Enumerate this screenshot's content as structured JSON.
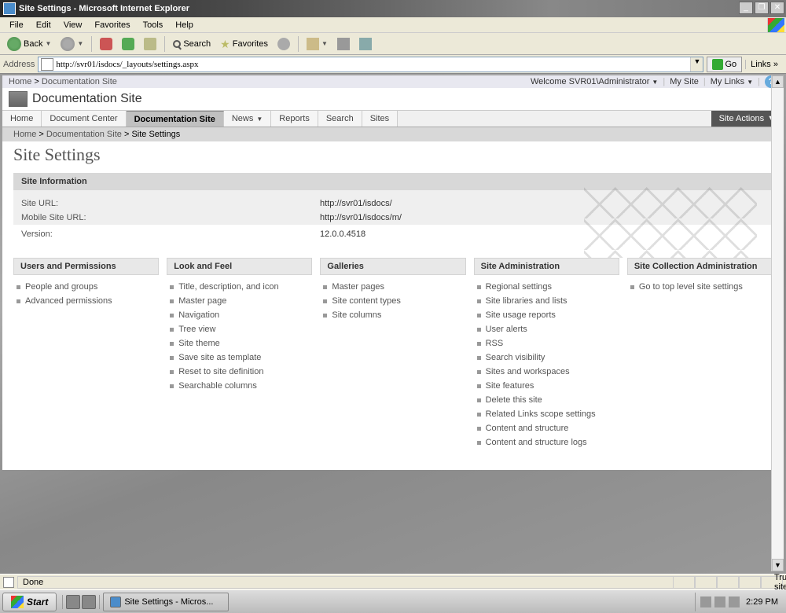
{
  "window": {
    "title": "Site Settings - Microsoft Internet Explorer",
    "controls": {
      "min": "_",
      "max": "❐",
      "close": "✕"
    }
  },
  "menubar": {
    "file": "File",
    "edit": "Edit",
    "view": "View",
    "favorites": "Favorites",
    "tools": "Tools",
    "help": "Help"
  },
  "toolbar": {
    "back": "Back",
    "search": "Search",
    "favorites": "Favorites"
  },
  "address": {
    "label": "Address",
    "url": "http://svr01/isdocs/_layouts/settings.aspx",
    "go": "Go",
    "links": "Links"
  },
  "sp": {
    "topcrumb_home": "Home",
    "topcrumb_site": "Documentation Site",
    "welcome": "Welcome SVR01\\Administrator",
    "mysite": "My Site",
    "mylinks": "My Links",
    "site_title": "Documentation Site",
    "tabs": {
      "home": "Home",
      "doccenter": "Document Center",
      "docsite": "Documentation Site",
      "news": "News",
      "reports": "Reports",
      "search": "Search",
      "sites": "Sites"
    },
    "site_actions": "Site Actions",
    "bc": {
      "home": "Home",
      "docsite": "Documentation Site",
      "settings": "Site Settings"
    },
    "h1": "Site Settings",
    "info": {
      "header": "Site Information",
      "url_label": "Site URL:",
      "url_val": "http://svr01/isdocs/",
      "mobile_label": "Mobile Site URL:",
      "mobile_val": "http://svr01/isdocs/m/",
      "version_label": "Version:",
      "version_val": "12.0.0.4518"
    },
    "cols": {
      "users": {
        "header": "Users and Permissions",
        "items": [
          "People and groups",
          "Advanced permissions"
        ]
      },
      "look": {
        "header": "Look and Feel",
        "items": [
          "Title, description, and icon",
          "Master page",
          "Navigation",
          "Tree view",
          "Site theme",
          "Save site as template",
          "Reset to site definition",
          "Searchable columns"
        ]
      },
      "galleries": {
        "header": "Galleries",
        "items": [
          "Master pages",
          "Site content types",
          "Site columns"
        ]
      },
      "admin": {
        "header": "Site Administration",
        "items": [
          "Regional settings",
          "Site libraries and lists",
          "Site usage reports",
          "User alerts",
          "RSS",
          "Search visibility",
          "Sites and workspaces",
          "Site features",
          "Delete this site",
          "Related Links scope settings",
          "Content and structure",
          "Content and structure logs"
        ]
      },
      "collection": {
        "header": "Site Collection Administration",
        "items": [
          "Go to top level site settings"
        ]
      }
    }
  },
  "status": {
    "done": "Done",
    "trusted": "Trusted sites"
  },
  "taskbar": {
    "start": "Start",
    "task": "Site Settings - Micros...",
    "clock": "2:29 PM"
  }
}
